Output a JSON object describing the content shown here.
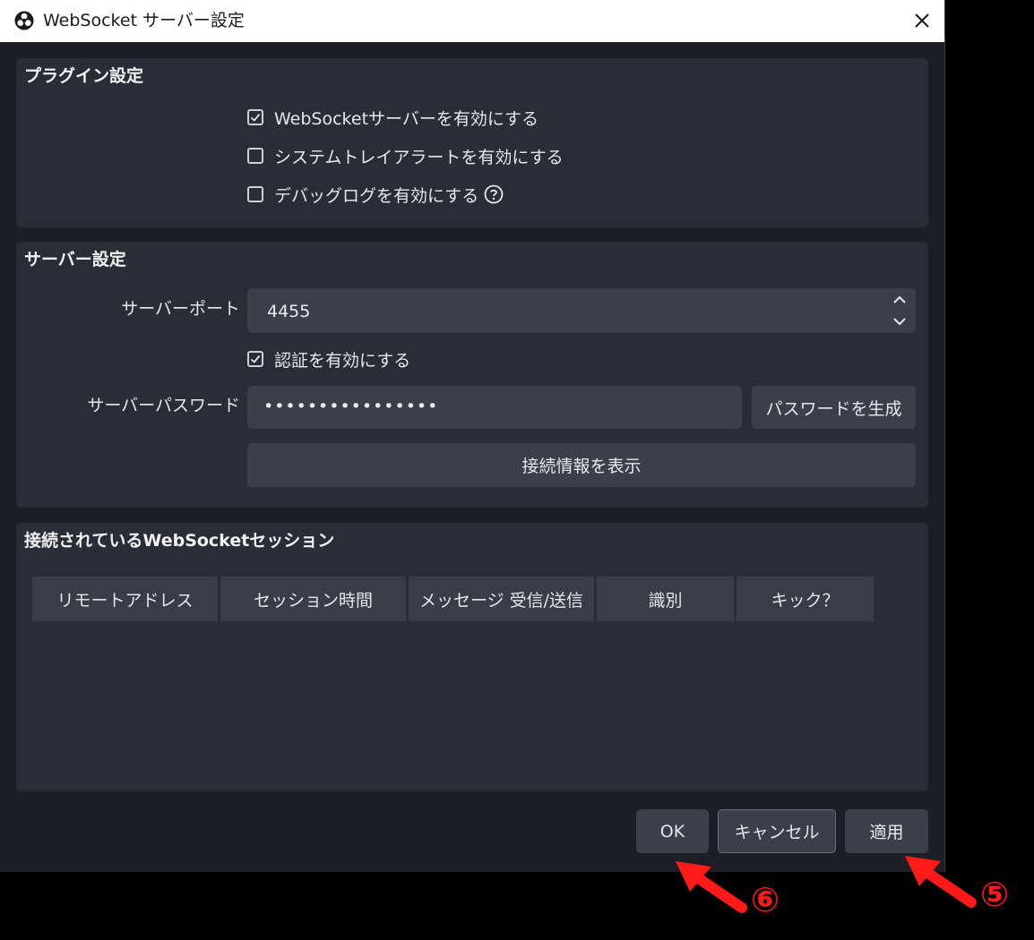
{
  "window": {
    "title": "WebSocket サーバー設定"
  },
  "plugin_settings": {
    "title": "プラグイン設定",
    "enable_server": {
      "label": "WebSocketサーバーを有効にする",
      "checked": true
    },
    "enable_tray_alerts": {
      "label": "システムトレイアラートを有効にする",
      "checked": false
    },
    "enable_debug_log": {
      "label": "デバッグログを有効にする",
      "checked": false
    }
  },
  "server_settings": {
    "title": "サーバー設定",
    "port_label": "サーバーポート",
    "port_value": "4455",
    "auth": {
      "label": "認証を有効にする",
      "checked": true
    },
    "password_label": "サーバーパスワード",
    "password_value": "••••••••••••••••",
    "generate_password_button": "パスワードを生成",
    "show_connect_info_button": "接続情報を表示"
  },
  "sessions": {
    "title": "接続されているWebSocketセッション",
    "columns": [
      "リモートアドレス",
      "セッション時間",
      "メッセージ 受信/送信",
      "識別",
      "キック？"
    ]
  },
  "footer": {
    "ok_button": "OK",
    "cancel_button": "キャンセル",
    "apply_button": "適用"
  },
  "annotations": {
    "ok_marker": "⑥",
    "apply_marker": "⑤",
    "color": "#ff1a1a"
  }
}
